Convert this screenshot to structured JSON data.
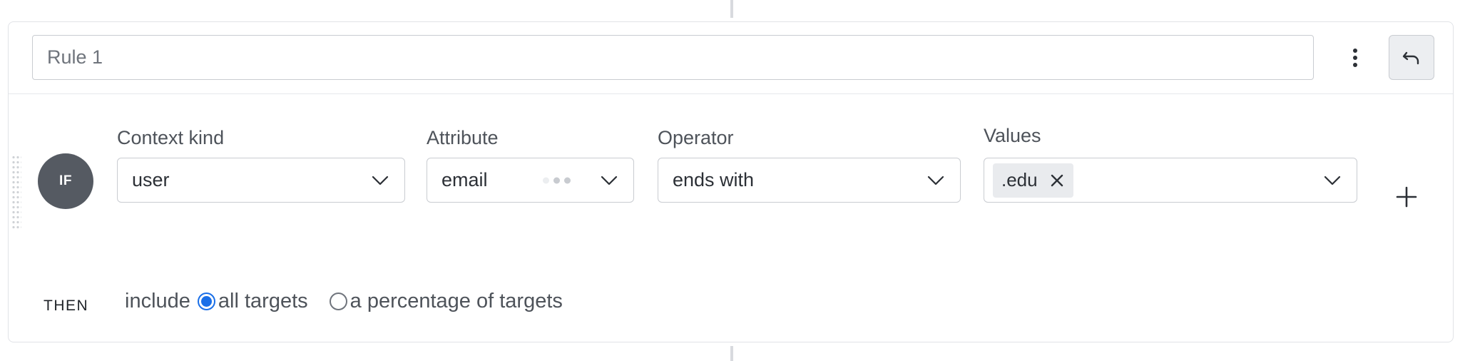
{
  "rule": {
    "name_placeholder": "Rule 1",
    "name_value": ""
  },
  "icons": {
    "kebab": "more-vertical-icon",
    "undo": "undo-icon",
    "chevron": "chevron-down-icon",
    "remove": "close-icon",
    "add": "plus-icon"
  },
  "condition": {
    "badge": "IF",
    "context_kind": {
      "label": "Context kind",
      "value": "user"
    },
    "attribute": {
      "label": "Attribute",
      "value": "email"
    },
    "operator": {
      "label": "Operator",
      "value": "ends with"
    },
    "values": {
      "label": "Values",
      "chips": [
        ".edu"
      ]
    }
  },
  "then": {
    "label": "THEN",
    "include_text": "include",
    "options": [
      {
        "label": "all targets",
        "checked": true
      },
      {
        "label": "a percentage of targets",
        "checked": false
      }
    ]
  },
  "colors": {
    "accent": "#1a6fe8",
    "badge": "#555a62"
  }
}
